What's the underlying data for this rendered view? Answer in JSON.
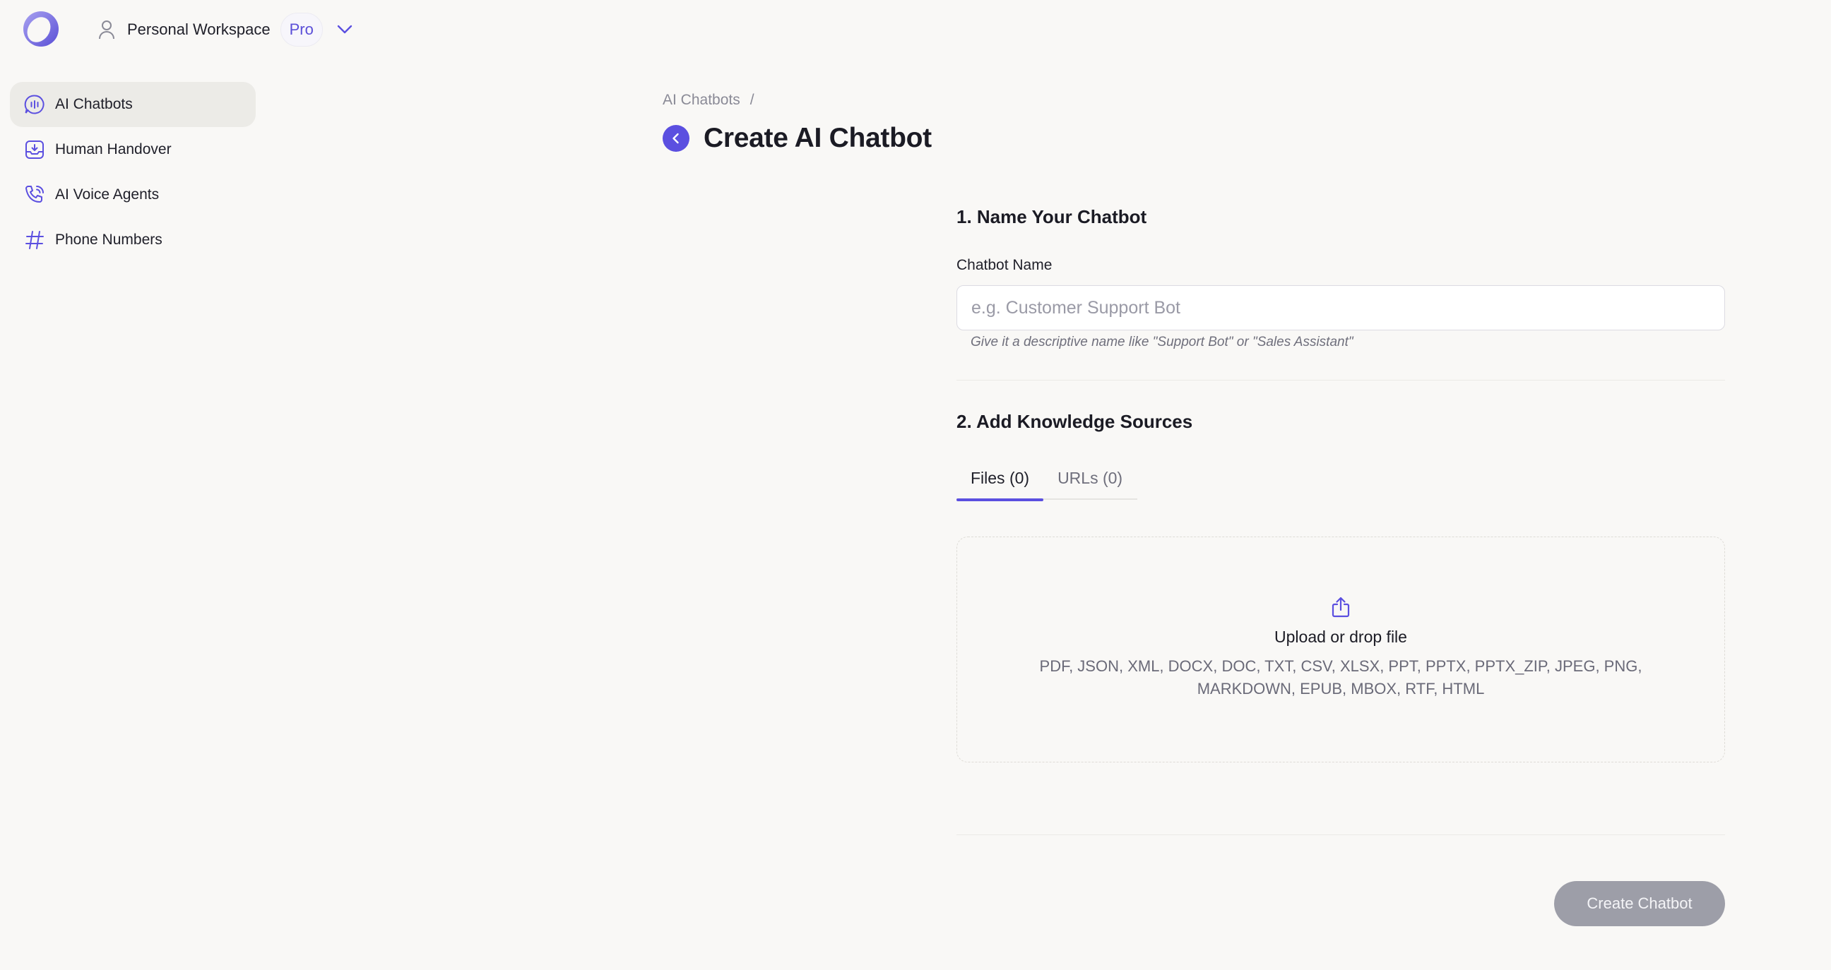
{
  "header": {
    "workspace_name": "Personal Workspace",
    "plan_badge": "Pro"
  },
  "sidebar": {
    "items": [
      {
        "label": "AI Chatbots",
        "icon": "chatbot-icon",
        "active": true
      },
      {
        "label": "Human Handover",
        "icon": "inbox-download-icon",
        "active": false
      },
      {
        "label": "AI Voice Agents",
        "icon": "phone-call-icon",
        "active": false
      },
      {
        "label": "Phone Numbers",
        "icon": "hash-icon",
        "active": false
      }
    ]
  },
  "breadcrumb": {
    "parent": "AI Chatbots",
    "separator": "/"
  },
  "page": {
    "title": "Create AI Chatbot"
  },
  "form": {
    "section1_title": "1. Name Your Chatbot",
    "name_label": "Chatbot Name",
    "name_value": "",
    "name_placeholder": "e.g. Customer Support Bot",
    "name_hint": "Give it a descriptive name like \"Support Bot\" or \"Sales Assistant\"",
    "section2_title": "2. Add Knowledge Sources",
    "tabs": [
      {
        "label": "Files (0)",
        "active": true
      },
      {
        "label": "URLs (0)",
        "active": false
      }
    ],
    "upload_title": "Upload or drop file",
    "upload_types": "PDF, JSON, XML, DOCX, DOC, TXT, CSV, XLSX, PPT, PPTX, PPTX_ZIP, JPEG, PNG, MARKDOWN, EPUB, MBOX, RTF, HTML",
    "submit_label": "Create Chatbot"
  },
  "colors": {
    "accent": "#5b4fe0",
    "background": "#f9f8f6",
    "disabled_button": "#9d9ea8"
  }
}
